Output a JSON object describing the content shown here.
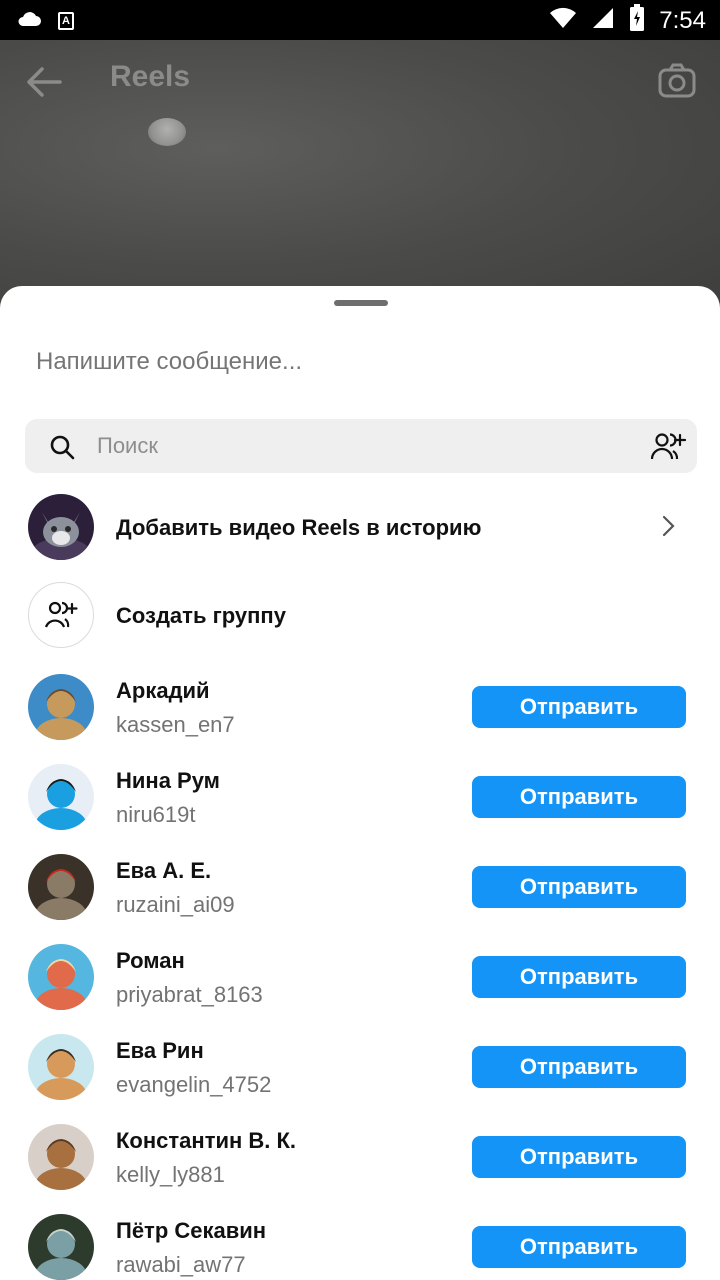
{
  "status_bar": {
    "time": "7:54",
    "left_icons": [
      "cloud-icon",
      "a-badge-icon"
    ],
    "right_icons": [
      "wifi-icon",
      "signal-icon",
      "battery-icon"
    ],
    "a_badge": "A"
  },
  "background": {
    "title": "Reels"
  },
  "sheet": {
    "message_placeholder": "Напишите сообщение...",
    "search_placeholder": "Поиск",
    "add_story_label": "Добавить видео Reels в историю",
    "create_group_label": "Создать группу",
    "send_label": "Отправить",
    "contacts": [
      {
        "name": "Аркадий",
        "username": "kassen_en7",
        "avatar_colors": [
          "#3d8cc7",
          "#c69a5c",
          "#6b4a2a"
        ]
      },
      {
        "name": "Нина Рум",
        "username": "niru619t",
        "avatar_colors": [
          "#e8eef5",
          "#1aa0e0",
          "#1a1a1a"
        ]
      },
      {
        "name": "Ева А. Е.",
        "username": "ruzaini_ai09",
        "avatar_colors": [
          "#3a3228",
          "#8a7b66",
          "#c8281e"
        ]
      },
      {
        "name": "Роман",
        "username": "priyabrat_8163",
        "avatar_colors": [
          "#55b7e0",
          "#e06a4a",
          "#f2d9a4"
        ]
      },
      {
        "name": "Ева Рин",
        "username": "evangelin_4752",
        "avatar_colors": [
          "#c9e7ef",
          "#d89a5a",
          "#3a2a22"
        ]
      },
      {
        "name": "Константин В. К.",
        "username": "kelly_ly881",
        "avatar_colors": [
          "#d8cfc8",
          "#a8703e",
          "#5a3a22"
        ]
      },
      {
        "name": "Пётр Секавин",
        "username": "rawabi_aw77",
        "avatar_colors": [
          "#2d3b2d",
          "#7aa0a6",
          "#c9d2cc"
        ]
      }
    ]
  }
}
